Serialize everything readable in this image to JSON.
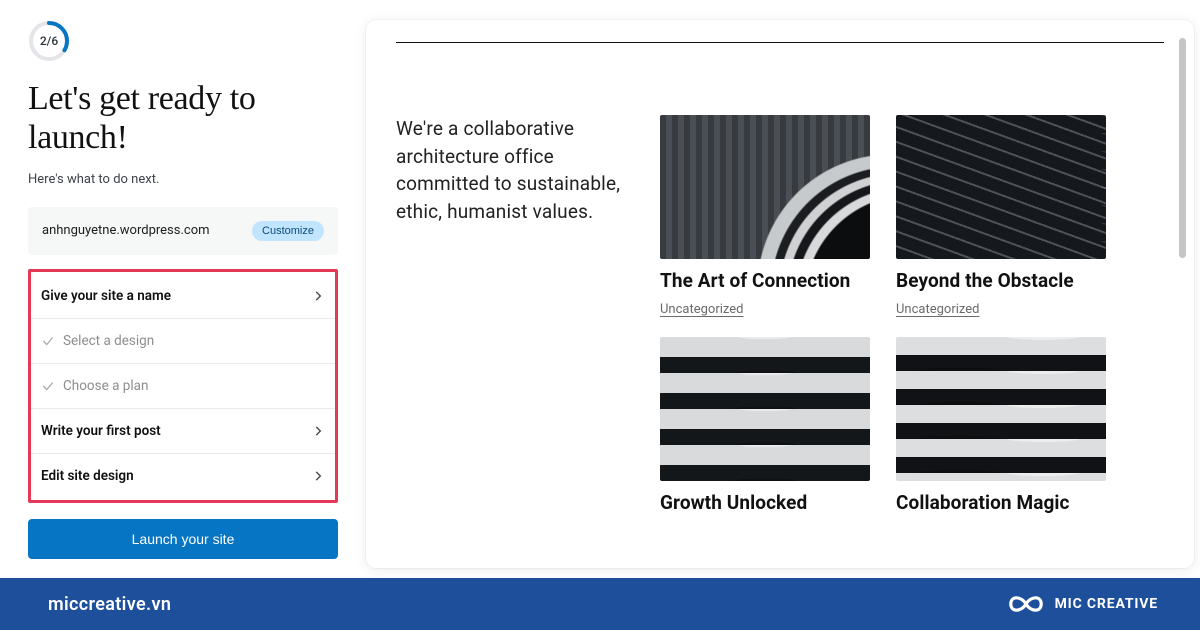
{
  "progress": {
    "step_label": "2/6",
    "current": 2,
    "total": 6
  },
  "headline": "Let's get ready to launch!",
  "subhead": "Here's what to do next.",
  "domain": {
    "url": "anhnguyetne.wordpress.com",
    "customize_label": "Customize"
  },
  "tasks": {
    "name": {
      "label": "Give your site a name",
      "state": "todo"
    },
    "design": {
      "label": "Select a design",
      "state": "done"
    },
    "plan": {
      "label": "Choose a plan",
      "state": "done"
    },
    "first_post": {
      "label": "Write your first post",
      "state": "todo"
    },
    "edit_design": {
      "label": "Edit site design",
      "state": "todo"
    }
  },
  "launch_label": "Launch your site",
  "preview": {
    "tagline": "We're a collaborative architecture office committed to sustainable, ethic, humanist values.",
    "posts": [
      {
        "title": "The Art of Connection",
        "category": "Uncategorized"
      },
      {
        "title": "Beyond the Obstacle",
        "category": "Uncategorized"
      },
      {
        "title": "Growth Unlocked",
        "category": ""
      },
      {
        "title": "Collaboration Magic",
        "category": ""
      }
    ]
  },
  "footer": {
    "site": "miccreative.vn",
    "brand": "MIC CREATIVE"
  }
}
